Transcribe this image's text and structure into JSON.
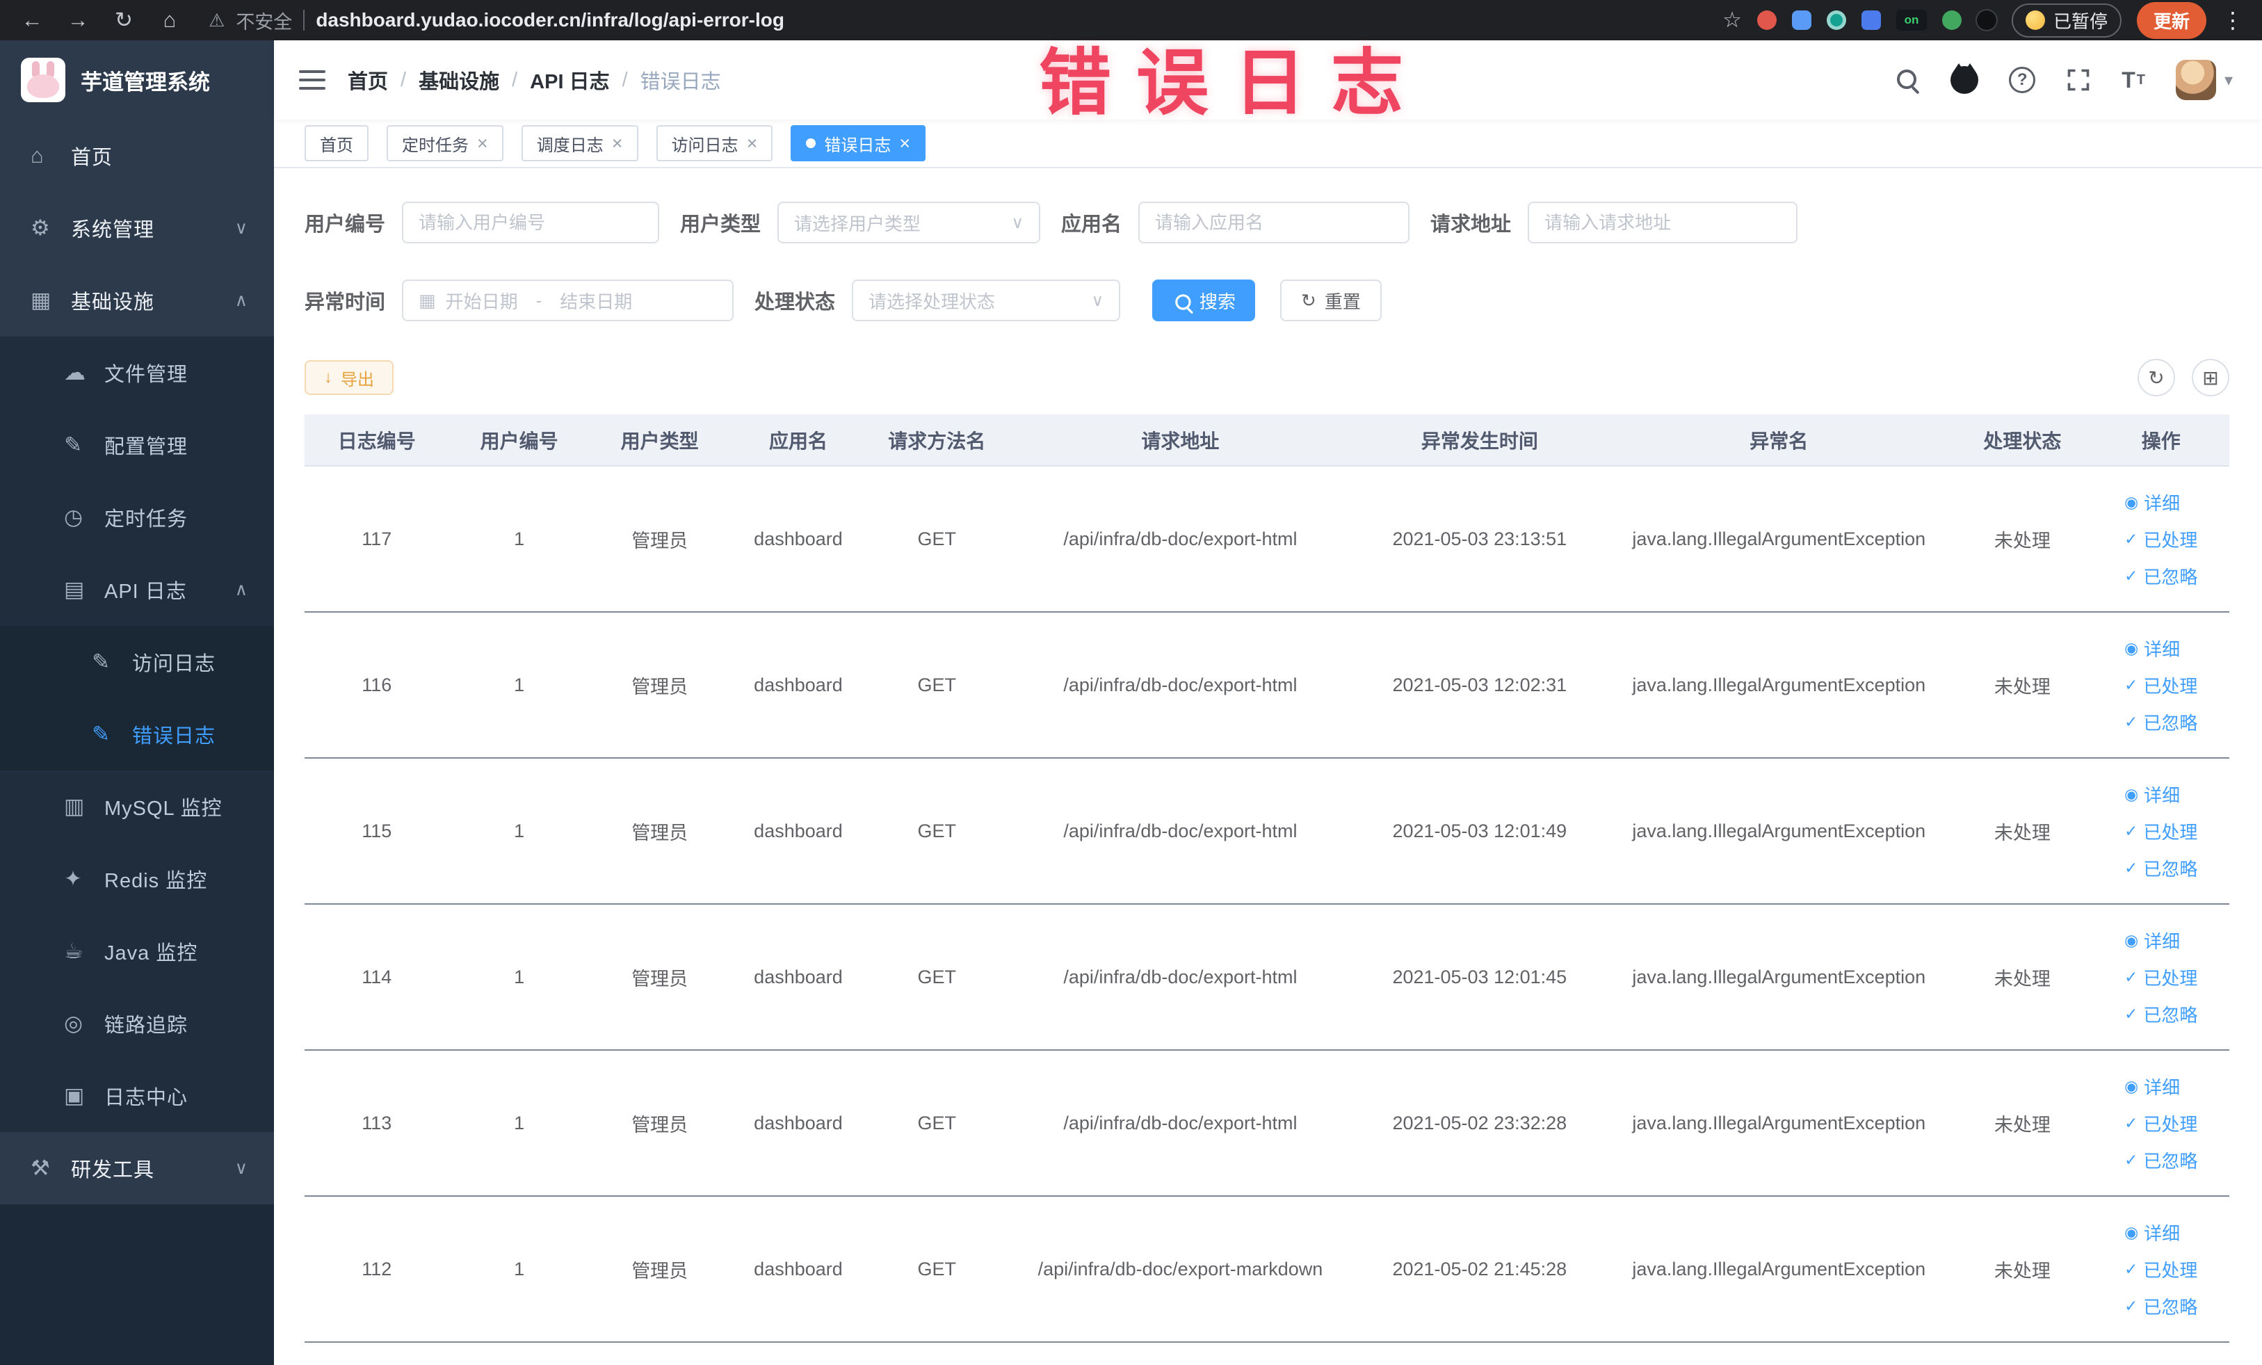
{
  "browser": {
    "security_label": "不安全",
    "url": "dashboard.yudao.iocoder.cn/infra/log/api-error-log",
    "paused_label": "已暂停",
    "update_label": "更新",
    "extension_on_label": "on"
  },
  "icons": {
    "back": "←",
    "forward": "→",
    "reload": "↻",
    "home": "⌂",
    "warning": "⚠",
    "star": "☆",
    "menu_dots": "⋮",
    "caret_down": "▾",
    "slash": "/",
    "chevron_down": "∨",
    "chevron_up": "∧",
    "select_chevron": "∨",
    "question": "?",
    "font_large": "T",
    "font_small": "T",
    "calendar": "▦",
    "view": "◉",
    "check": "✓",
    "refresh": "↻",
    "grid": "⊞",
    "download": "↓",
    "close": "×",
    "menu_home": "⌂",
    "menu_system": "⚙",
    "menu_infra": "▦",
    "menu_file": "☁",
    "menu_config": "✎",
    "menu_job": "◷",
    "menu_api_log": "▤",
    "menu_doc": "✎",
    "menu_mysql": "▥",
    "menu_redis": "✦",
    "menu_java": "☕",
    "menu_trace": "◎",
    "menu_logcenter": "▣",
    "menu_devtools": "⚒"
  },
  "sidebar": {
    "logo_title": "芋道管理系统",
    "items": [
      {
        "label": "首页"
      },
      {
        "label": "系统管理"
      },
      {
        "label": "基础设施"
      },
      {
        "label": "文件管理"
      },
      {
        "label": "配置管理"
      },
      {
        "label": "定时任务"
      },
      {
        "label": "API 日志"
      },
      {
        "label": "访问日志"
      },
      {
        "label": "错误日志"
      },
      {
        "label": "MySQL 监控"
      },
      {
        "label": "Redis 监控"
      },
      {
        "label": "Java 监控"
      },
      {
        "label": "链路追踪"
      },
      {
        "label": "日志中心"
      },
      {
        "label": "研发工具"
      }
    ]
  },
  "header": {
    "breadcrumb": [
      "首页",
      "基础设施",
      "API 日志",
      "错误日志"
    ],
    "watermark": "错误日志"
  },
  "tabs": [
    {
      "label": "首页"
    },
    {
      "label": "定时任务"
    },
    {
      "label": "调度日志"
    },
    {
      "label": "访问日志"
    },
    {
      "label": "错误日志"
    }
  ],
  "filters": {
    "user_id": {
      "label": "用户编号",
      "placeholder": "请输入用户编号"
    },
    "user_type": {
      "label": "用户类型",
      "placeholder": "请选择用户类型"
    },
    "app_name": {
      "label": "应用名",
      "placeholder": "请输入应用名"
    },
    "request_url": {
      "label": "请求地址",
      "placeholder": "请输入请求地址"
    },
    "exception_time": {
      "label": "异常时间",
      "start_placeholder": "开始日期",
      "separator": "-",
      "end_placeholder": "结束日期"
    },
    "process_status": {
      "label": "处理状态",
      "placeholder": "请选择处理状态"
    },
    "search_label": "搜索",
    "reset_label": "重置"
  },
  "toolbar": {
    "export_label": "导出"
  },
  "table": {
    "columns": [
      "日志编号",
      "用户编号",
      "用户类型",
      "应用名",
      "请求方法名",
      "请求地址",
      "异常发生时间",
      "异常名",
      "处理状态",
      "操作"
    ],
    "rows": [
      [
        "117",
        "1",
        "管理员",
        "dashboard",
        "GET",
        "/api/infra/db-doc/export-html",
        "2021-05-03 23:13:51",
        "java.lang.IllegalArgumentException",
        "未处理"
      ],
      [
        "116",
        "1",
        "管理员",
        "dashboard",
        "GET",
        "/api/infra/db-doc/export-html",
        "2021-05-03 12:02:31",
        "java.lang.IllegalArgumentException",
        "未处理"
      ],
      [
        "115",
        "1",
        "管理员",
        "dashboard",
        "GET",
        "/api/infra/db-doc/export-html",
        "2021-05-03 12:01:49",
        "java.lang.IllegalArgumentException",
        "未处理"
      ],
      [
        "114",
        "1",
        "管理员",
        "dashboard",
        "GET",
        "/api/infra/db-doc/export-html",
        "2021-05-03 12:01:45",
        "java.lang.IllegalArgumentException",
        "未处理"
      ],
      [
        "113",
        "1",
        "管理员",
        "dashboard",
        "GET",
        "/api/infra/db-doc/export-html",
        "2021-05-02 23:32:28",
        "java.lang.IllegalArgumentException",
        "未处理"
      ],
      [
        "112",
        "1",
        "管理员",
        "dashboard",
        "GET",
        "/api/infra/db-doc/export-markdown",
        "2021-05-02 21:45:28",
        "java.lang.IllegalArgumentException",
        "未处理"
      ]
    ],
    "actions": [
      "详细",
      "已处理",
      "已忽略"
    ]
  },
  "colors": {
    "accent": "#409eff",
    "watermark": "#ef4560",
    "sidebar_bg": "#2d3a4b",
    "sidebar_sub_bg": "#1f2d3d",
    "warning_button_text": "#e6a23c",
    "active_tab_bg": "#409eff"
  }
}
